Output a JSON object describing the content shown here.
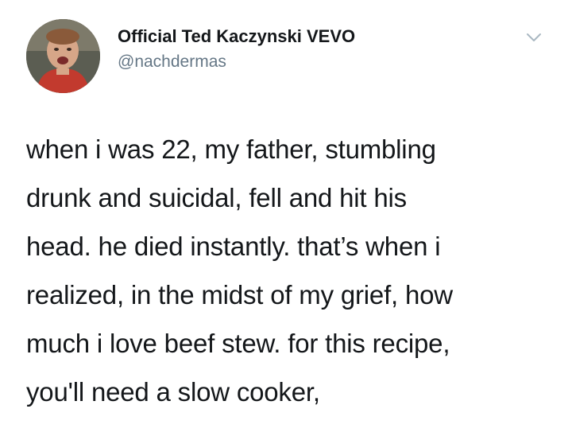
{
  "tweet": {
    "display_name": "Official Ted Kaczynski VEVO",
    "handle": "@nachdermas",
    "text_lines": [
      "when i was 22, my father, stumbling",
      "drunk and suicidal, fell and hit his",
      "head. he died instantly. that’s when i",
      "realized, in the midst of my grief, how",
      "much i love beef stew. for this recipe,",
      "you'll need a slow cooker,"
    ]
  },
  "icons": {
    "avatar": "profile-photo",
    "menu": "chevron-down-icon"
  },
  "colors": {
    "text": "#14171a",
    "secondary": "#657786",
    "chevron": "#aab8c2",
    "background": "#ffffff"
  }
}
